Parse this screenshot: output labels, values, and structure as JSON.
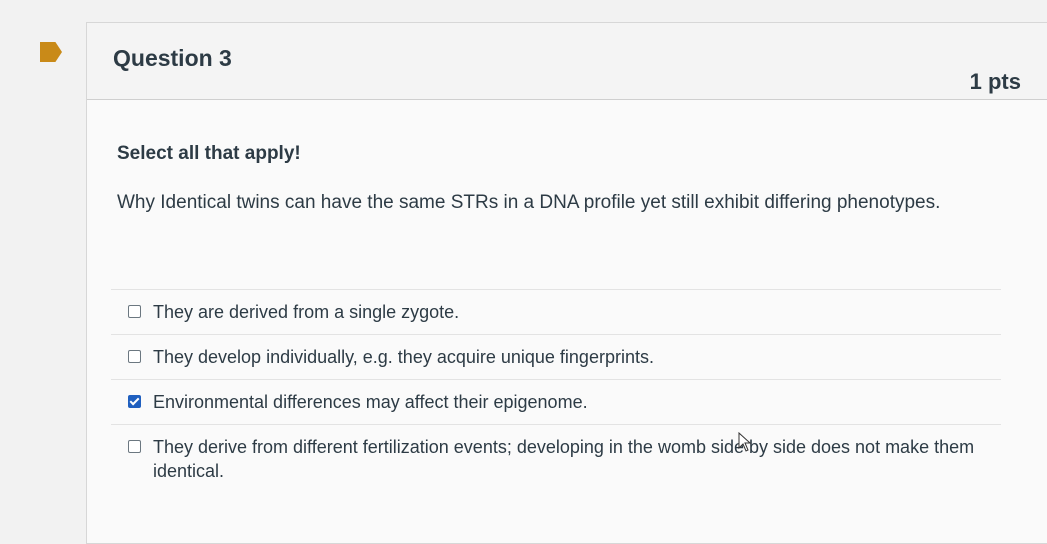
{
  "header": {
    "title": "Question 3",
    "points": "1 pts"
  },
  "body": {
    "instruction": "Select all that apply!",
    "prompt": "Why Identical twins can have the same STRs in a DNA profile yet still exhibit differing phenotypes."
  },
  "answers": [
    {
      "label": "They are derived from a single zygote.",
      "checked": false
    },
    {
      "label": "They develop individually, e.g. they acquire unique fingerprints.",
      "checked": false
    },
    {
      "label": "Environmental differences may affect their epigenome.",
      "checked": true
    },
    {
      "label": "They derive from different fertilization events; developing in the womb side by side does not make them identical.",
      "checked": false
    }
  ],
  "colors": {
    "flag": "#c98a18",
    "checkbox_checked": "#1f5fbf",
    "text": "#2d3b45"
  },
  "icons": {
    "flag": "bookmark-flag-icon",
    "cursor": "mouse-pointer-icon"
  }
}
